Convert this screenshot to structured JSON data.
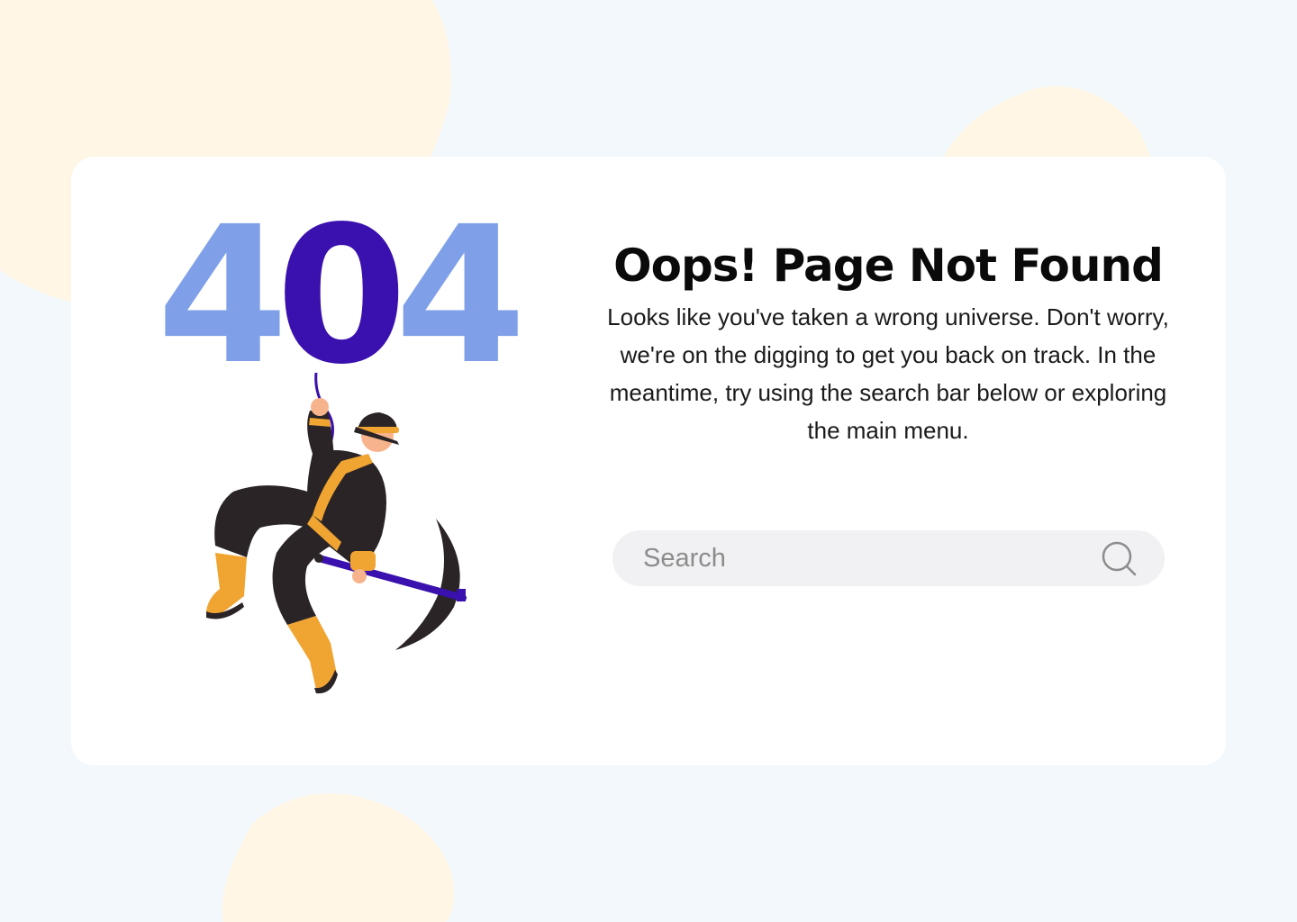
{
  "error": {
    "digits": [
      "4",
      "0",
      "4"
    ]
  },
  "content": {
    "title": "Oops! Page Not Found",
    "description": "Looks like you've taken a wrong universe. Don't worry, we're on the digging to get you back on track. In the meantime, try using the search bar below or exploring the main menu."
  },
  "search": {
    "placeholder": "Search",
    "icon": "search-icon"
  },
  "colors": {
    "background": "#F2F8FB",
    "blob": "#FFF6E6",
    "card": "#FFFFFF",
    "digit_four": "#7FA0E8",
    "digit_zero": "#3A10AE",
    "search_bg": "#F1F1F3",
    "miner_suit": "#2A2426",
    "miner_accent": "#F0A431"
  }
}
